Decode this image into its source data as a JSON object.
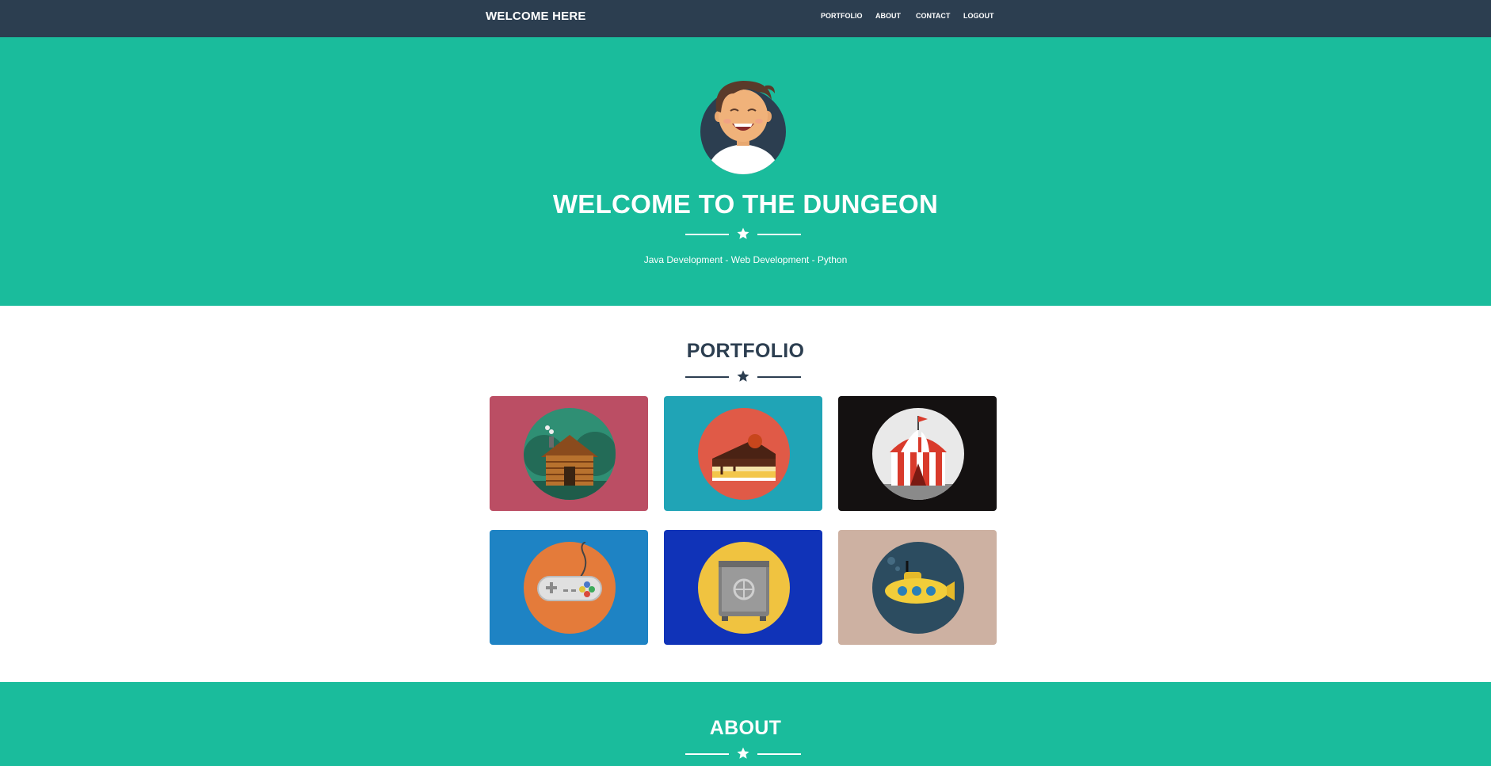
{
  "nav": {
    "brand": "WELCOME HERE",
    "links": [
      "PORTFOLIO",
      "ABOUT",
      "CONTACT",
      "LOGOUT"
    ]
  },
  "hero": {
    "title": "WELCOME TO THE DUNGEON",
    "subtitle": "Java Development - Web Development - Python",
    "divider_icon": "star-icon"
  },
  "portfolio": {
    "title": "PORTFOLIO",
    "items": [
      {
        "name": "log-cabin",
        "bg": "#bb4e64",
        "circle": "#2f8f74"
      },
      {
        "name": "cake-slice",
        "bg": "#20a4b6",
        "circle": "#e05a47"
      },
      {
        "name": "circus-tent",
        "bg": "#141111",
        "circle": "#e9e9e9"
      },
      {
        "name": "game-controller",
        "bg": "#1e83c4",
        "circle": "#e47b3a"
      },
      {
        "name": "safe",
        "bg": "#1033b8",
        "circle": "#f0c340"
      },
      {
        "name": "submarine",
        "bg": "#cdb1a2",
        "circle": "#2c4c60"
      }
    ]
  },
  "about": {
    "title": "ABOUT"
  },
  "colors": {
    "primary": "#2c3e50",
    "accent": "#1abc9c",
    "white": "#ffffff"
  }
}
